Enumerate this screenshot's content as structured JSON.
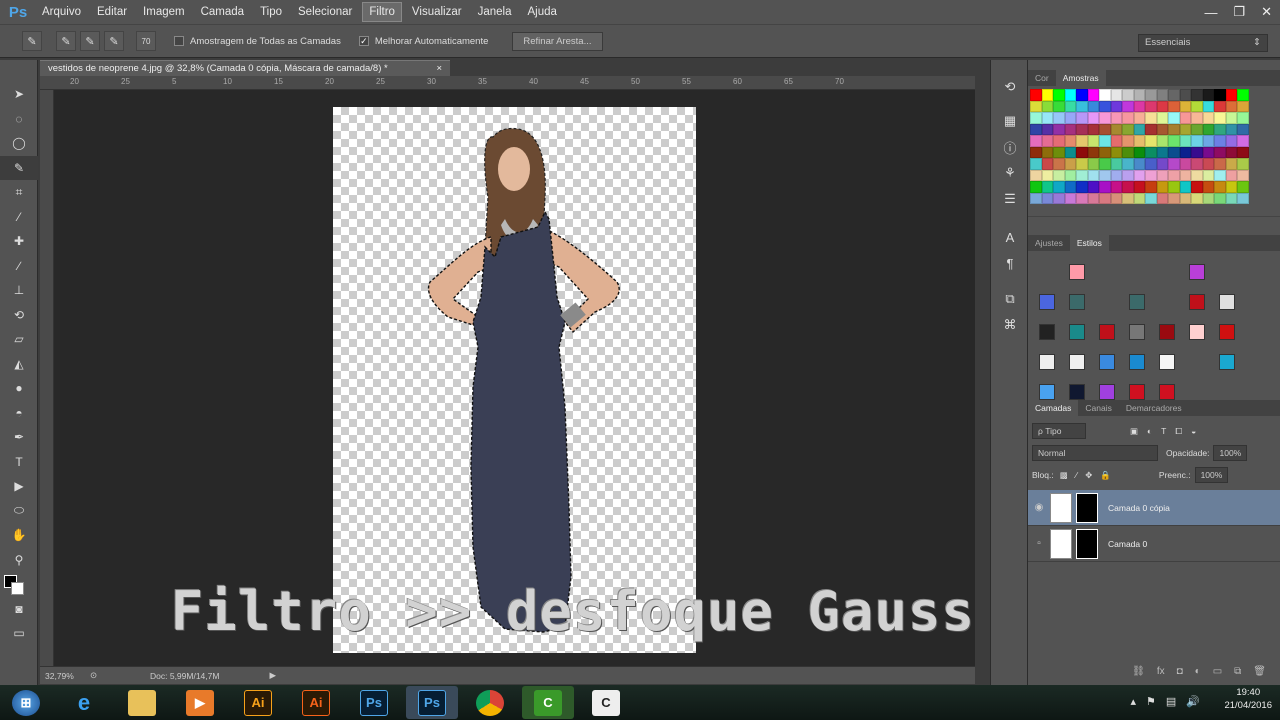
{
  "app": {
    "logo": "Ps"
  },
  "menu": [
    "Arquivo",
    "Editar",
    "Imagem",
    "Camada",
    "Tipo",
    "Selecionar",
    "Filtro",
    "Visualizar",
    "Janela",
    "Ajuda"
  ],
  "menu_active": "Filtro",
  "window_controls": [
    "—",
    "❐",
    "✕"
  ],
  "options": {
    "sample_all_layers": "Amostragem de Todas as Camadas",
    "auto_enhance": "Melhorar Automaticamente",
    "refine_button": "Refinar Aresta...",
    "workspace": "Essenciais",
    "brush_size": "70"
  },
  "document": {
    "tab_title": "vestidos de neoprene 4.jpg @ 32,8% (Camada 0 cópia, Máscara de camada/8) *",
    "zoom": "32,79%",
    "doc_info": "Doc: 5,99M/14,7M",
    "ruler_ticks": [
      "20",
      "25",
      "5",
      "10",
      "15",
      "20",
      "25",
      "30",
      "35",
      "40",
      "45",
      "50",
      "55",
      "60",
      "65",
      "70"
    ]
  },
  "caption": "Filtro >> desfoque Gaussiano",
  "panels": {
    "swatches_tabs": [
      "Cor",
      "Amostras"
    ],
    "swatches_active": "Amostras",
    "styles_tabs": [
      "Ajustes",
      "Estilos"
    ],
    "styles_active": "Estilos",
    "layers_tabs": [
      "Camadas",
      "Canais",
      "Demarcadores"
    ],
    "layers_active": "Camadas",
    "filter_kind": "ρ Tipo",
    "blend_mode": "Normal",
    "opacity_label": "Opacidade:",
    "opacity_value": "100%",
    "lock_label": "Bloq.:",
    "fill_label": "Preenc.:",
    "fill_value": "100%",
    "layers": [
      {
        "name": "Camada 0 cópia",
        "visible": true,
        "selected": true
      },
      {
        "name": "Camada 0",
        "visible": false,
        "selected": false
      }
    ]
  },
  "taskbar": {
    "items": [
      "start",
      "ie",
      "explorer",
      "media",
      "illustrator",
      "illustrator",
      "photoshop",
      "photoshop",
      "chrome",
      "corel",
      "corel"
    ],
    "time": "19:40",
    "date": "21/04/2016"
  },
  "colors": {
    "ui_bg": "#535353",
    "canvas_bg": "#282828",
    "selected_layer": "#6a7f9a",
    "ps_blue": "#4fa6e8",
    "dress": "#3a3f55"
  }
}
